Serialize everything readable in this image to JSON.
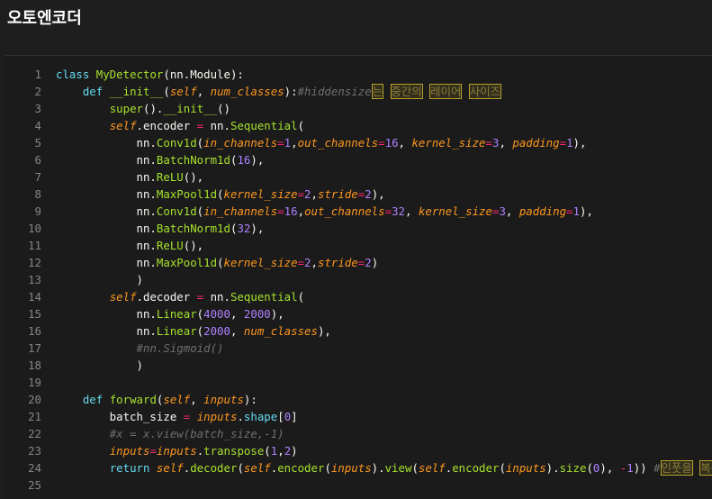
{
  "title": "오토엔코더",
  "code": {
    "lines": [
      {
        "n": "1",
        "tokens": [
          [
            "kw",
            "class "
          ],
          [
            "cls",
            "MyDetector"
          ],
          [
            "pn",
            "(nn.Module):"
          ]
        ]
      },
      {
        "n": "2",
        "tokens": [
          [
            "pn",
            "    "
          ],
          [
            "kw",
            "def "
          ],
          [
            "fn",
            "__init__"
          ],
          [
            "pn",
            "("
          ],
          [
            "arg",
            "self"
          ],
          [
            "pn",
            ", "
          ],
          [
            "arg",
            "num_classes"
          ],
          [
            "pn",
            "):"
          ],
          [
            "cm",
            "#hiddensize"
          ],
          [
            "hl",
            "는"
          ],
          [
            "cm",
            " "
          ],
          [
            "hl",
            "중간의"
          ],
          [
            "cm",
            " "
          ],
          [
            "hl",
            "레이어"
          ],
          [
            "cm",
            " "
          ],
          [
            "hl",
            "사이즈"
          ]
        ]
      },
      {
        "n": "3",
        "tokens": [
          [
            "pn",
            "        "
          ],
          [
            "fn",
            "super"
          ],
          [
            "pn",
            "()."
          ],
          [
            "fn",
            "__init__"
          ],
          [
            "pn",
            "()"
          ]
        ]
      },
      {
        "n": "4",
        "tokens": [
          [
            "pn",
            "        "
          ],
          [
            "arg",
            "self"
          ],
          [
            "pn",
            ".encoder "
          ],
          [
            "op",
            "="
          ],
          [
            "pn",
            " nn."
          ],
          [
            "fn",
            "Sequential"
          ],
          [
            "pn",
            "("
          ]
        ]
      },
      {
        "n": "5",
        "tokens": [
          [
            "pn",
            "            nn."
          ],
          [
            "fn",
            "Conv1d"
          ],
          [
            "pn",
            "("
          ],
          [
            "arg",
            "in_channels"
          ],
          [
            "op",
            "="
          ],
          [
            "num",
            "1"
          ],
          [
            "pn",
            ","
          ],
          [
            "arg",
            "out_channels"
          ],
          [
            "op",
            "="
          ],
          [
            "num",
            "16"
          ],
          [
            "pn",
            ", "
          ],
          [
            "arg",
            "kernel_size"
          ],
          [
            "op",
            "="
          ],
          [
            "num",
            "3"
          ],
          [
            "pn",
            ", "
          ],
          [
            "arg",
            "padding"
          ],
          [
            "op",
            "="
          ],
          [
            "num",
            "1"
          ],
          [
            "pn",
            "),"
          ]
        ]
      },
      {
        "n": "6",
        "tokens": [
          [
            "pn",
            "            nn."
          ],
          [
            "fn",
            "BatchNorm1d"
          ],
          [
            "pn",
            "("
          ],
          [
            "num",
            "16"
          ],
          [
            "pn",
            "),"
          ]
        ]
      },
      {
        "n": "7",
        "tokens": [
          [
            "pn",
            "            nn."
          ],
          [
            "fn",
            "ReLU"
          ],
          [
            "pn",
            "(),"
          ]
        ]
      },
      {
        "n": "8",
        "tokens": [
          [
            "pn",
            "            nn."
          ],
          [
            "fn",
            "MaxPool1d"
          ],
          [
            "pn",
            "("
          ],
          [
            "arg",
            "kernel_size"
          ],
          [
            "op",
            "="
          ],
          [
            "num",
            "2"
          ],
          [
            "pn",
            ","
          ],
          [
            "arg",
            "stride"
          ],
          [
            "op",
            "="
          ],
          [
            "num",
            "2"
          ],
          [
            "pn",
            "),"
          ]
        ]
      },
      {
        "n": "9",
        "tokens": [
          [
            "pn",
            "            nn."
          ],
          [
            "fn",
            "Conv1d"
          ],
          [
            "pn",
            "("
          ],
          [
            "arg",
            "in_channels"
          ],
          [
            "op",
            "="
          ],
          [
            "num",
            "16"
          ],
          [
            "pn",
            ","
          ],
          [
            "arg",
            "out_channels"
          ],
          [
            "op",
            "="
          ],
          [
            "num",
            "32"
          ],
          [
            "pn",
            ", "
          ],
          [
            "arg",
            "kernel_size"
          ],
          [
            "op",
            "="
          ],
          [
            "num",
            "3"
          ],
          [
            "pn",
            ", "
          ],
          [
            "arg",
            "padding"
          ],
          [
            "op",
            "="
          ],
          [
            "num",
            "1"
          ],
          [
            "pn",
            "),"
          ]
        ]
      },
      {
        "n": "10",
        "tokens": [
          [
            "pn",
            "            nn."
          ],
          [
            "fn",
            "BatchNorm1d"
          ],
          [
            "pn",
            "("
          ],
          [
            "num",
            "32"
          ],
          [
            "pn",
            "),"
          ]
        ]
      },
      {
        "n": "11",
        "tokens": [
          [
            "pn",
            "            nn."
          ],
          [
            "fn",
            "ReLU"
          ],
          [
            "pn",
            "(),"
          ]
        ]
      },
      {
        "n": "12",
        "tokens": [
          [
            "pn",
            "            nn."
          ],
          [
            "fn",
            "MaxPool1d"
          ],
          [
            "pn",
            "("
          ],
          [
            "arg",
            "kernel_size"
          ],
          [
            "op",
            "="
          ],
          [
            "num",
            "2"
          ],
          [
            "pn",
            ","
          ],
          [
            "arg",
            "stride"
          ],
          [
            "op",
            "="
          ],
          [
            "num",
            "2"
          ],
          [
            "pn",
            ")"
          ]
        ]
      },
      {
        "n": "13",
        "tokens": [
          [
            "pn",
            "            )"
          ]
        ]
      },
      {
        "n": "14",
        "tokens": [
          [
            "pn",
            "        "
          ],
          [
            "arg",
            "self"
          ],
          [
            "pn",
            ".decoder "
          ],
          [
            "op",
            "="
          ],
          [
            "pn",
            " nn."
          ],
          [
            "fn",
            "Sequential"
          ],
          [
            "pn",
            "("
          ]
        ]
      },
      {
        "n": "15",
        "tokens": [
          [
            "pn",
            "            nn."
          ],
          [
            "fn",
            "Linear"
          ],
          [
            "pn",
            "("
          ],
          [
            "num",
            "4000"
          ],
          [
            "pn",
            ", "
          ],
          [
            "num",
            "2000"
          ],
          [
            "pn",
            "),"
          ]
        ]
      },
      {
        "n": "16",
        "tokens": [
          [
            "pn",
            "            nn."
          ],
          [
            "fn",
            "Linear"
          ],
          [
            "pn",
            "("
          ],
          [
            "num",
            "2000"
          ],
          [
            "pn",
            ", "
          ],
          [
            "arg",
            "num_classes"
          ],
          [
            "pn",
            "),"
          ]
        ]
      },
      {
        "n": "17",
        "tokens": [
          [
            "pn",
            "            "
          ],
          [
            "cm",
            "#nn.Sigmoid()"
          ]
        ]
      },
      {
        "n": "18",
        "tokens": [
          [
            "pn",
            "            )"
          ]
        ]
      },
      {
        "n": "19",
        "tokens": []
      },
      {
        "n": "20",
        "tokens": [
          [
            "pn",
            "    "
          ],
          [
            "kw",
            "def "
          ],
          [
            "fn",
            "forward"
          ],
          [
            "pn",
            "("
          ],
          [
            "arg",
            "self"
          ],
          [
            "pn",
            ", "
          ],
          [
            "arg",
            "inputs"
          ],
          [
            "pn",
            "):"
          ]
        ]
      },
      {
        "n": "21",
        "tokens": [
          [
            "pn",
            "        batch_size "
          ],
          [
            "op",
            "="
          ],
          [
            "pn",
            " "
          ],
          [
            "arg",
            "inputs"
          ],
          [
            "pn",
            "."
          ],
          [
            "attr",
            "shape"
          ],
          [
            "pn",
            "["
          ],
          [
            "num",
            "0"
          ],
          [
            "pn",
            "]"
          ]
        ]
      },
      {
        "n": "22",
        "tokens": [
          [
            "pn",
            "        "
          ],
          [
            "cm",
            "#x = x.view(batch_size,-1)"
          ]
        ]
      },
      {
        "n": "23",
        "tokens": [
          [
            "pn",
            "        "
          ],
          [
            "arg",
            "inputs"
          ],
          [
            "op",
            "="
          ],
          [
            "arg",
            "inputs"
          ],
          [
            "pn",
            "."
          ],
          [
            "fn",
            "transpose"
          ],
          [
            "pn",
            "("
          ],
          [
            "num",
            "1"
          ],
          [
            "pn",
            ","
          ],
          [
            "num",
            "2"
          ],
          [
            "pn",
            ")"
          ]
        ]
      },
      {
        "n": "24",
        "tokens": [
          [
            "pn",
            "        "
          ],
          [
            "kw",
            "return "
          ],
          [
            "arg",
            "self"
          ],
          [
            "pn",
            "."
          ],
          [
            "fn",
            "decoder"
          ],
          [
            "pn",
            "("
          ],
          [
            "arg",
            "self"
          ],
          [
            "pn",
            "."
          ],
          [
            "fn",
            "encoder"
          ],
          [
            "pn",
            "("
          ],
          [
            "arg",
            "inputs"
          ],
          [
            "pn",
            ")."
          ],
          [
            "fn",
            "view"
          ],
          [
            "pn",
            "("
          ],
          [
            "arg",
            "self"
          ],
          [
            "pn",
            "."
          ],
          [
            "fn",
            "encoder"
          ],
          [
            "pn",
            "("
          ],
          [
            "arg",
            "inputs"
          ],
          [
            "pn",
            ")."
          ],
          [
            "fn",
            "size"
          ],
          [
            "pn",
            "("
          ],
          [
            "num",
            "0"
          ],
          [
            "pn",
            "), "
          ],
          [
            "op",
            "-"
          ],
          [
            "num",
            "1"
          ],
          [
            "pn",
            "))"
          ],
          [
            "cm",
            " #"
          ],
          [
            "hl",
            "인풋을"
          ],
          [
            "cm",
            " "
          ],
          [
            "hl",
            "복원"
          ],
          [
            "cm",
            ")"
          ]
        ]
      },
      {
        "n": "25",
        "tokens": []
      }
    ]
  },
  "colors": {
    "background": "#1e1e1e",
    "editor_background": "#1b1b1b",
    "line_number": "#858585",
    "keyword": "#66d9ef",
    "function": "#a6e22e",
    "argument": "#fd971f",
    "number": "#ae81ff",
    "operator": "#f92672",
    "comment": "#6f6f6f",
    "highlight_border": "#b9a22a"
  }
}
